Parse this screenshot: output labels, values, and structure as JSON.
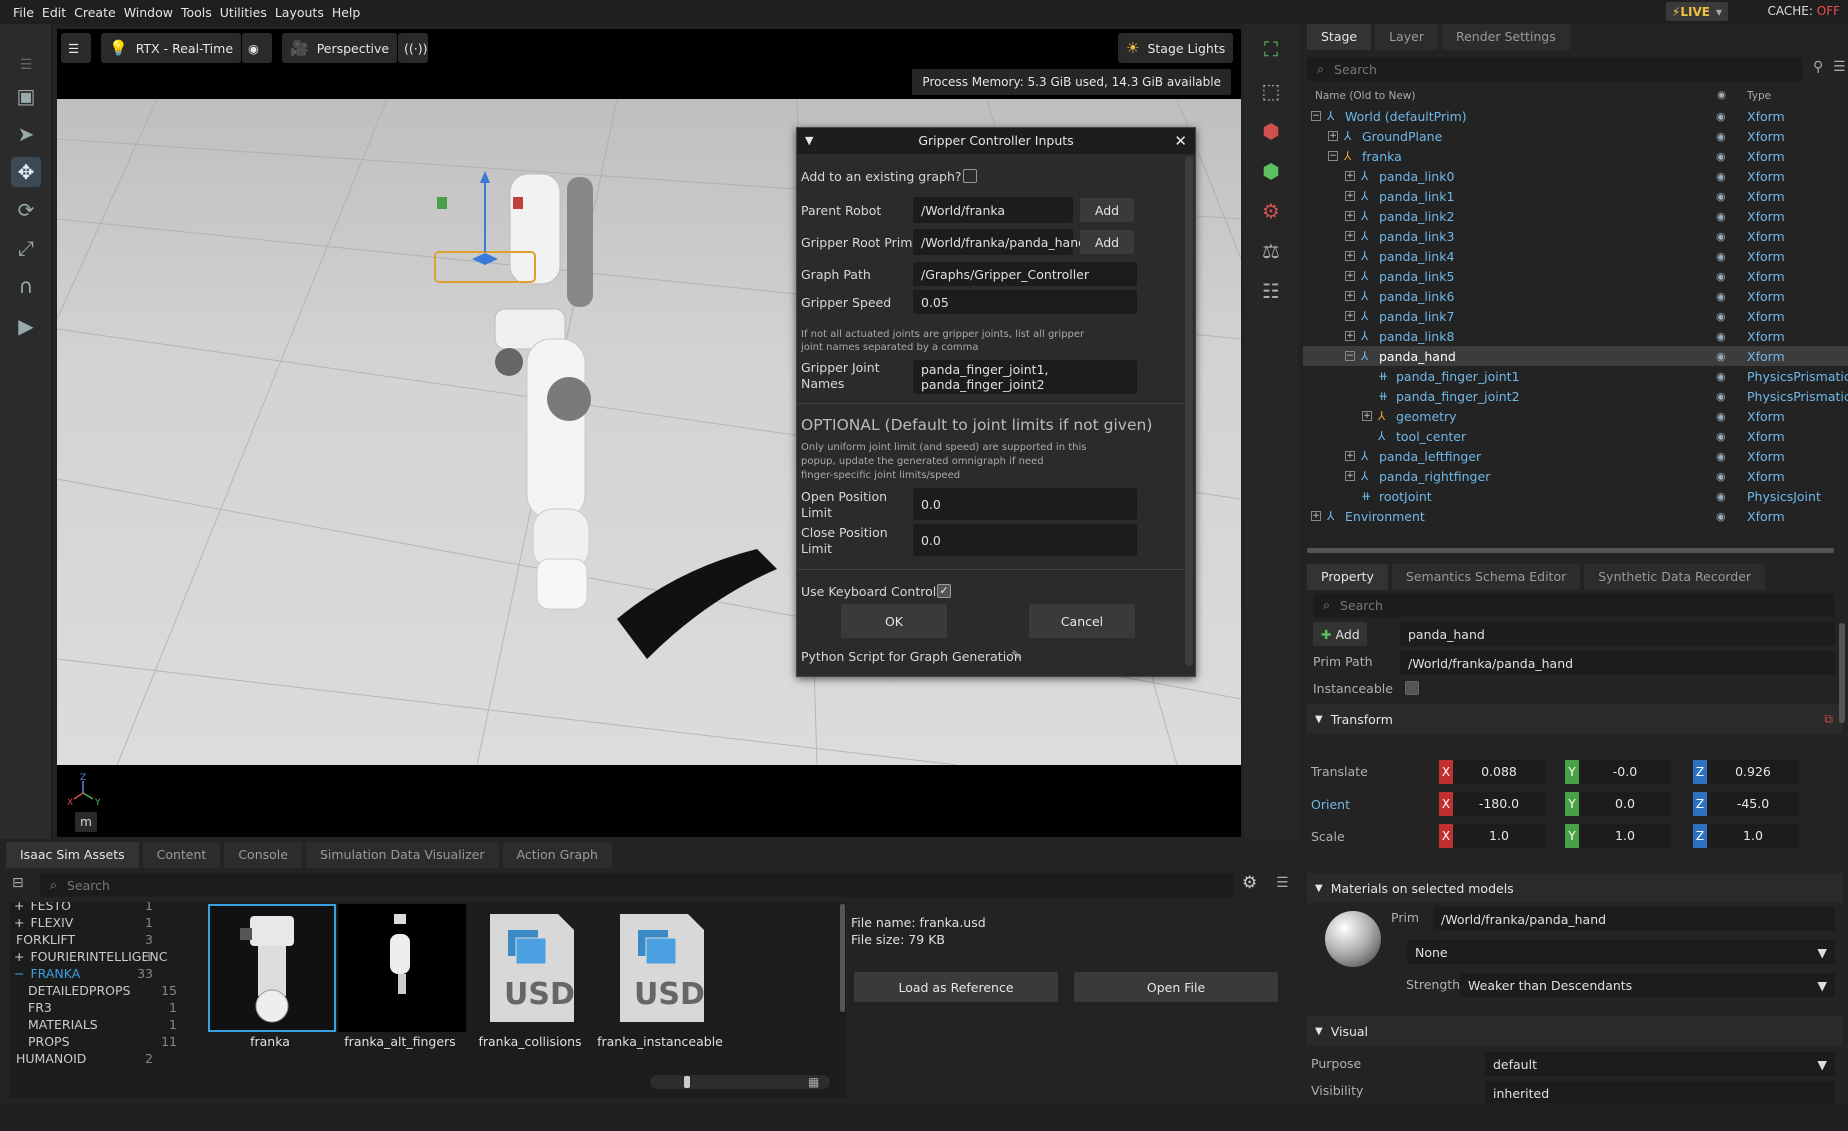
{
  "menubar": {
    "items": [
      "File",
      "Edit",
      "Create",
      "Window",
      "Tools",
      "Utilities",
      "Layouts",
      "Help"
    ],
    "live": "LIVE",
    "cache_label": "CACHE:",
    "cache_state": "OFF"
  },
  "viewport": {
    "render_mode": "RTX - Real-Time",
    "camera": "Perspective",
    "lights": "Stage Lights",
    "memory": "Process Memory: 5.3 GiB used, 14.3 GiB available",
    "axis_z": "Z",
    "axis_x": "X",
    "axis_y": "Y",
    "unit": "m"
  },
  "dialog": {
    "title": "Gripper Controller Inputs",
    "add_existing_label": "Add to an existing graph?",
    "parent_robot_label": "Parent Robot",
    "parent_robot_value": "/World/franka",
    "gripper_root_label": "Gripper Root Prim",
    "gripper_root_value": "/World/franka/panda_hand",
    "add_label": "Add",
    "graph_path_label": "Graph Path",
    "graph_path_value": "/Graphs/Gripper_Controller",
    "speed_label": "Gripper Speed",
    "speed_value": "0.05",
    "note1_line1": "If not all actuated joints are gripper joints, list all gripper",
    "note1_line2": "joint names separated by a comma",
    "joint_names_label1": "Gripper Joint",
    "joint_names_label2": "Names",
    "joint_names_value": "panda_finger_joint1, panda_finger_joint2",
    "optional_heading": "OPTIONAL (Default to joint limits if not given)",
    "note2_line1": "Only uniform joint limit (and speed) are supported in this",
    "note2_line2": "popup, update the generated omnigraph if need",
    "note2_line3": "finger-specific joint limits/speed",
    "open_limit_label1": "Open Position",
    "open_limit_label2": "Limit",
    "open_limit_value": "0.0",
    "close_limit_label1": "Close Position",
    "close_limit_label2": "Limit",
    "close_limit_value": "0.0",
    "keyboard_label": "Use Keyboard Control",
    "ok_label": "OK",
    "cancel_label": "Cancel",
    "python_label": "Python Script for Graph Generation"
  },
  "stage": {
    "tabs": [
      "Stage",
      "Layer",
      "Render Settings"
    ],
    "search_placeholder": "Search",
    "col_name": "Name (Old to New)",
    "col_type": "Type",
    "rows": [
      {
        "name": "World (defaultPrim)",
        "type": "Xform"
      },
      {
        "name": "GroundPlane",
        "type": "Xform"
      },
      {
        "name": "franka",
        "type": "Xform"
      },
      {
        "name": "panda_link0",
        "type": "Xform"
      },
      {
        "name": "panda_link1",
        "type": "Xform"
      },
      {
        "name": "panda_link2",
        "type": "Xform"
      },
      {
        "name": "panda_link3",
        "type": "Xform"
      },
      {
        "name": "panda_link4",
        "type": "Xform"
      },
      {
        "name": "panda_link5",
        "type": "Xform"
      },
      {
        "name": "panda_link6",
        "type": "Xform"
      },
      {
        "name": "panda_link7",
        "type": "Xform"
      },
      {
        "name": "panda_link8",
        "type": "Xform"
      },
      {
        "name": "panda_hand",
        "type": "Xform"
      },
      {
        "name": "panda_finger_joint1",
        "type": "PhysicsPrismatic"
      },
      {
        "name": "panda_finger_joint2",
        "type": "PhysicsPrismatic"
      },
      {
        "name": "geometry",
        "type": "Xform"
      },
      {
        "name": "tool_center",
        "type": "Xform"
      },
      {
        "name": "panda_leftfinger",
        "type": "Xform"
      },
      {
        "name": "panda_rightfinger",
        "type": "Xform"
      },
      {
        "name": "rootJoint",
        "type": "PhysicsJoint"
      },
      {
        "name": "Environment",
        "type": "Xform"
      }
    ]
  },
  "property": {
    "tabs": [
      "Property",
      "Semantics Schema Editor",
      "Synthetic Data Recorder"
    ],
    "search_placeholder": "Search",
    "add_label": "Add",
    "prim_name": "panda_hand",
    "prim_path_label": "Prim Path",
    "prim_path": "/World/franka/panda_hand",
    "instanceable_label": "Instanceable",
    "transform_label": "Transform",
    "translate_label": "Translate",
    "orient_label": "Orient",
    "scale_label": "Scale",
    "x": "X",
    "y": "Y",
    "z": "Z",
    "translate": [
      "0.088",
      "-0.0",
      "0.926"
    ],
    "orient": [
      "-180.0",
      "0.0",
      "-45.0"
    ],
    "scale": [
      "1.0",
      "1.0",
      "1.0"
    ],
    "materials_label": "Materials on selected models",
    "prim_label": "Prim",
    "material_prim": "/World/franka/panda_hand",
    "material_value": "None",
    "strength_label": "Strength",
    "strength_value": "Weaker than Descendants",
    "visual_label": "Visual",
    "purpose_label": "Purpose",
    "purpose_value": "default",
    "visibility_label": "Visibility",
    "visibility_value": "inherited"
  },
  "assets": {
    "tabs": [
      "Isaac Sim Assets",
      "Content",
      "Console",
      "Simulation Data Visualizer",
      "Action Graph"
    ],
    "search_placeholder": "Search",
    "tree": [
      {
        "name": "FESTO",
        "count": "1"
      },
      {
        "name": "FLEXIV",
        "count": "1"
      },
      {
        "name": "FORKLIFT",
        "count": "3"
      },
      {
        "name": "FOURIERINTELLIGENC",
        "count": "1"
      },
      {
        "name": "FRANKA",
        "count": "33"
      },
      {
        "name": "DETAILEDPROPS",
        "count": "15"
      },
      {
        "name": "FR3",
        "count": "1"
      },
      {
        "name": "MATERIALS",
        "count": "1"
      },
      {
        "name": "PROPS",
        "count": "11"
      },
      {
        "name": "HUMANOID",
        "count": "2"
      }
    ],
    "items": [
      "franka",
      "franka_alt_fingers",
      "franka_collisions",
      "franka_instanceable"
    ],
    "usd_text": "USD",
    "file_name": "File name: franka.usd",
    "file_size": "File size: 79 KB",
    "load_ref": "Load as Reference",
    "open_file": "Open File"
  },
  "colors": {
    "accent": "#70b8e8",
    "x_axis": "#c03030",
    "y_axis": "#48a048",
    "z_axis": "#3070c0",
    "cache_off": "#e85050"
  }
}
